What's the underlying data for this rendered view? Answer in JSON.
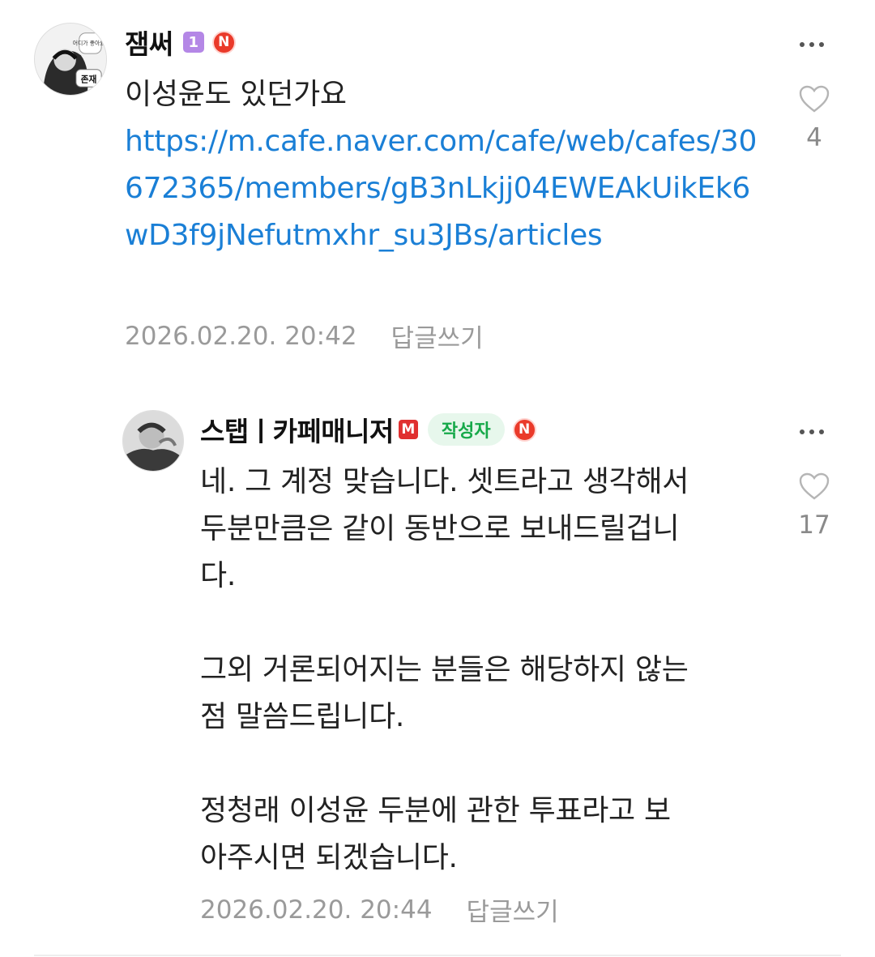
{
  "comments": [
    {
      "nickname": "잼써",
      "level_badge": "1",
      "naver_badge": "N",
      "avatar_text_top": "어디가 좋아요?",
      "avatar_text_bottom": "존재",
      "text": "이성윤도 있던가요",
      "link": "https://m.cafe.naver.com/cafe/web/cafes/30672365/members/gB3nLkjj04EWEAkUikEk6wD3f9jNefutmxhr_su3JBs/articles",
      "date": "2026.02.20. 20:42",
      "reply_label": "답글쓰기",
      "like_count": "4"
    },
    {
      "nickname": "스탭ㅣ카페매니저",
      "manager_badge": "M",
      "author_tag": "작성자",
      "naver_badge": "N",
      "text": "네. 그 계정 맞습니다. 셋트라고 생각해서\n두분만큼은 같이 동반으로 보내드릴겁니\n다.\n\n그외 거론되어지는 분들은 해당하지 않는\n점 말씀드립니다.\n\n정청래 이성윤 두분에 관한 투표라고 보\n아주시면 되겠습니다.",
      "date": "2026.02.20. 20:44",
      "reply_label": "답글쓰기",
      "like_count": "17"
    }
  ],
  "colors": {
    "link": "#1a7fd6",
    "author_tag_bg": "#e7f7ec",
    "author_tag_text": "#17a94a",
    "naver_badge": "#ea3a2a",
    "level_badge": "#b487e6",
    "manager_badge": "#e03030"
  }
}
